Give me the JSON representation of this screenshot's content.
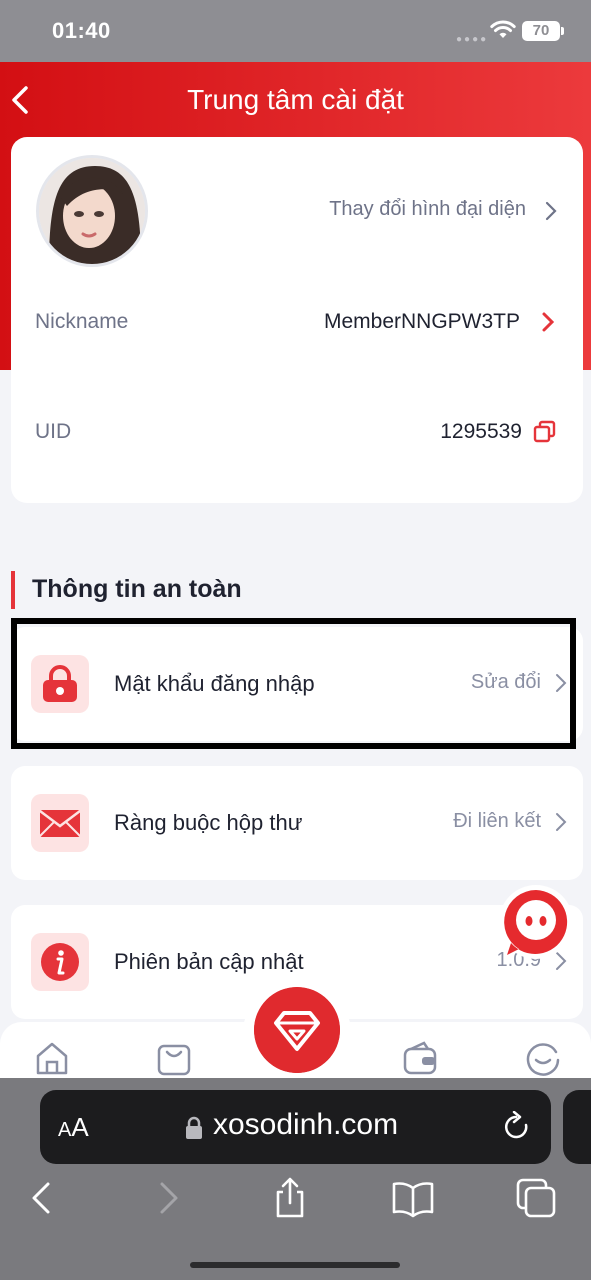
{
  "status_bar": {
    "time": "01:40",
    "battery": "70"
  },
  "header": {
    "title": "Trung tâm cài đặt"
  },
  "profile": {
    "change_avatar_label": "Thay đổi hình đại diện",
    "nickname_label": "Nickname",
    "nickname_value": "MemberNNGPW3TP",
    "uid_label": "UID",
    "uid_value": "1295539"
  },
  "security": {
    "section_title": "Thông tin an toàn",
    "items": [
      {
        "title": "Mật khẩu đăng nhập",
        "action": "Sửa đổi",
        "icon": "lock-icon"
      },
      {
        "title": "Ràng buộc hộp thư",
        "action": "Đi liên kết",
        "icon": "mail-icon"
      },
      {
        "title": "Phiên bản cập nhật",
        "action": "1.0.9",
        "icon": "info-icon"
      }
    ]
  },
  "tabbar": {
    "tabs": [
      "home-icon",
      "bag-icon",
      "diamond-icon",
      "wallet-icon",
      "profile-icon"
    ]
  },
  "browser": {
    "aa_label_small": "A",
    "aa_label_large": "A",
    "url": "xosodinh.com"
  },
  "colors": {
    "brand_red": "#e5343a",
    "header_red": "#d30f13"
  }
}
